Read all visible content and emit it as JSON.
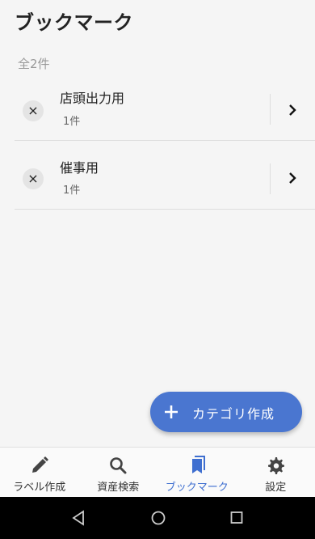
{
  "header": {
    "title": "ブックマーク"
  },
  "summary": {
    "count_text": "全2件"
  },
  "bookmarks": [
    {
      "name": "店頭出力用",
      "count": "1件"
    },
    {
      "name": "催事用",
      "count": "1件"
    }
  ],
  "fab": {
    "label": "カテゴリ作成",
    "icon": "plus-icon"
  },
  "bottom_nav": {
    "items": [
      {
        "label": "ラベル作成",
        "icon": "pencil-icon",
        "active": false
      },
      {
        "label": "資産検索",
        "icon": "search-icon",
        "active": false
      },
      {
        "label": "ブックマーク",
        "icon": "bookmark-icon",
        "active": true
      },
      {
        "label": "設定",
        "icon": "gear-icon",
        "active": false
      }
    ]
  },
  "colors": {
    "accent": "#4a76d0",
    "active_nav": "#3f6fd0",
    "background": "#f5f5f5"
  },
  "icons": {
    "remove": "×",
    "system_back": "back-triangle-icon",
    "system_home": "home-circle-icon",
    "system_recents": "recents-square-icon"
  }
}
